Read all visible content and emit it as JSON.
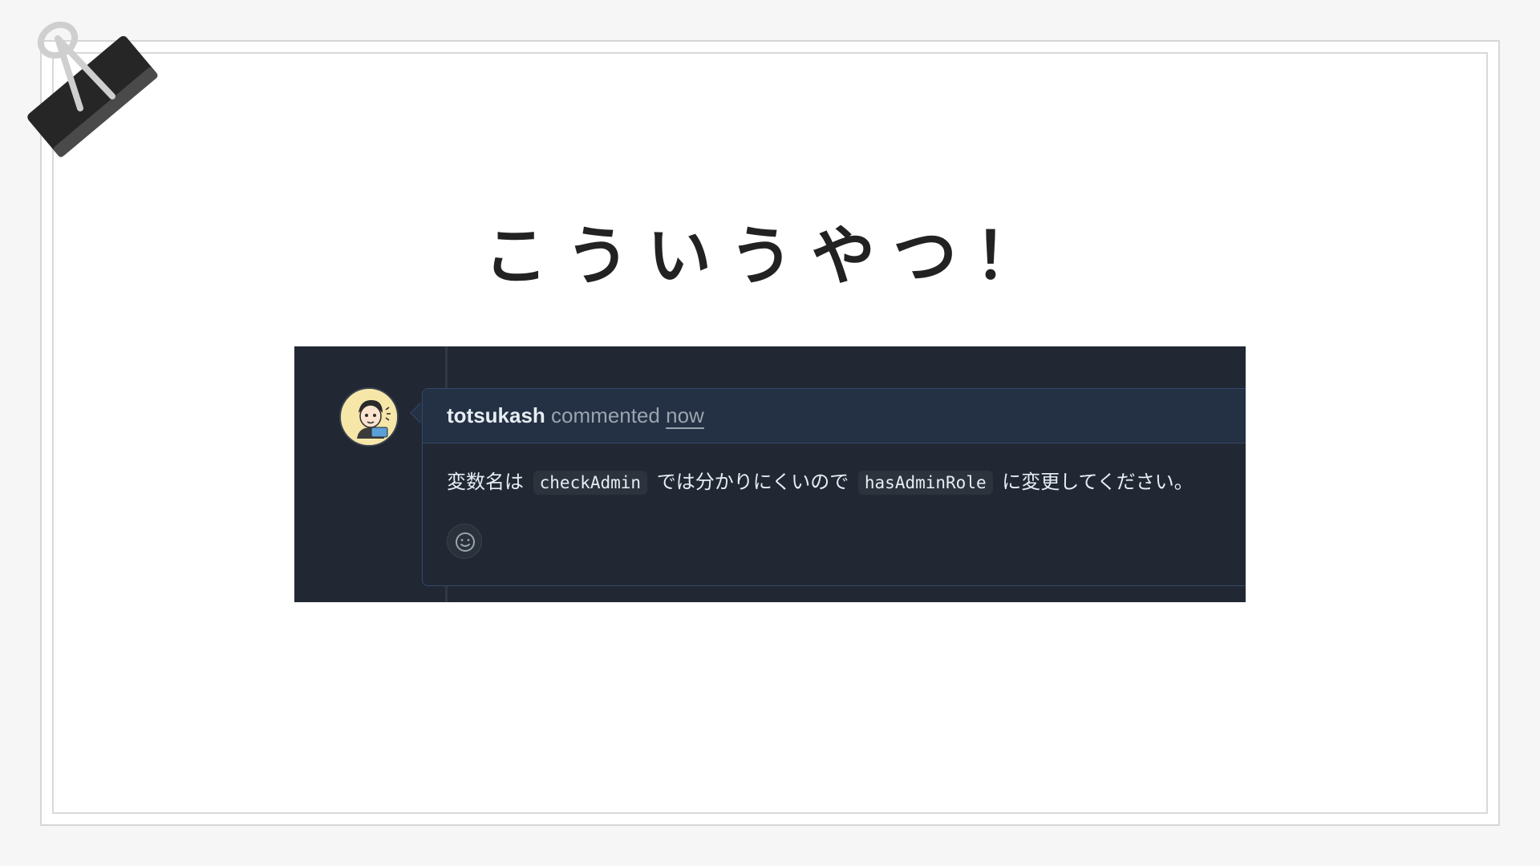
{
  "slide": {
    "title": "こういうやつ！"
  },
  "comment": {
    "author": "totsukash",
    "action": "commented",
    "time": "now",
    "body": {
      "text_before": "変数名は",
      "code_1": "checkAdmin",
      "text_middle": "では分かりにくいので",
      "code_2": "hasAdminRole",
      "text_after": "に変更してください。"
    }
  },
  "icons": {
    "binder_clip": "binder-clip-icon",
    "avatar": "avatar",
    "reaction": "smiley-icon"
  },
  "colors": {
    "panel_bg": "#212833",
    "header_bg": "#243043",
    "border": "#34496b",
    "title": "#222222"
  }
}
